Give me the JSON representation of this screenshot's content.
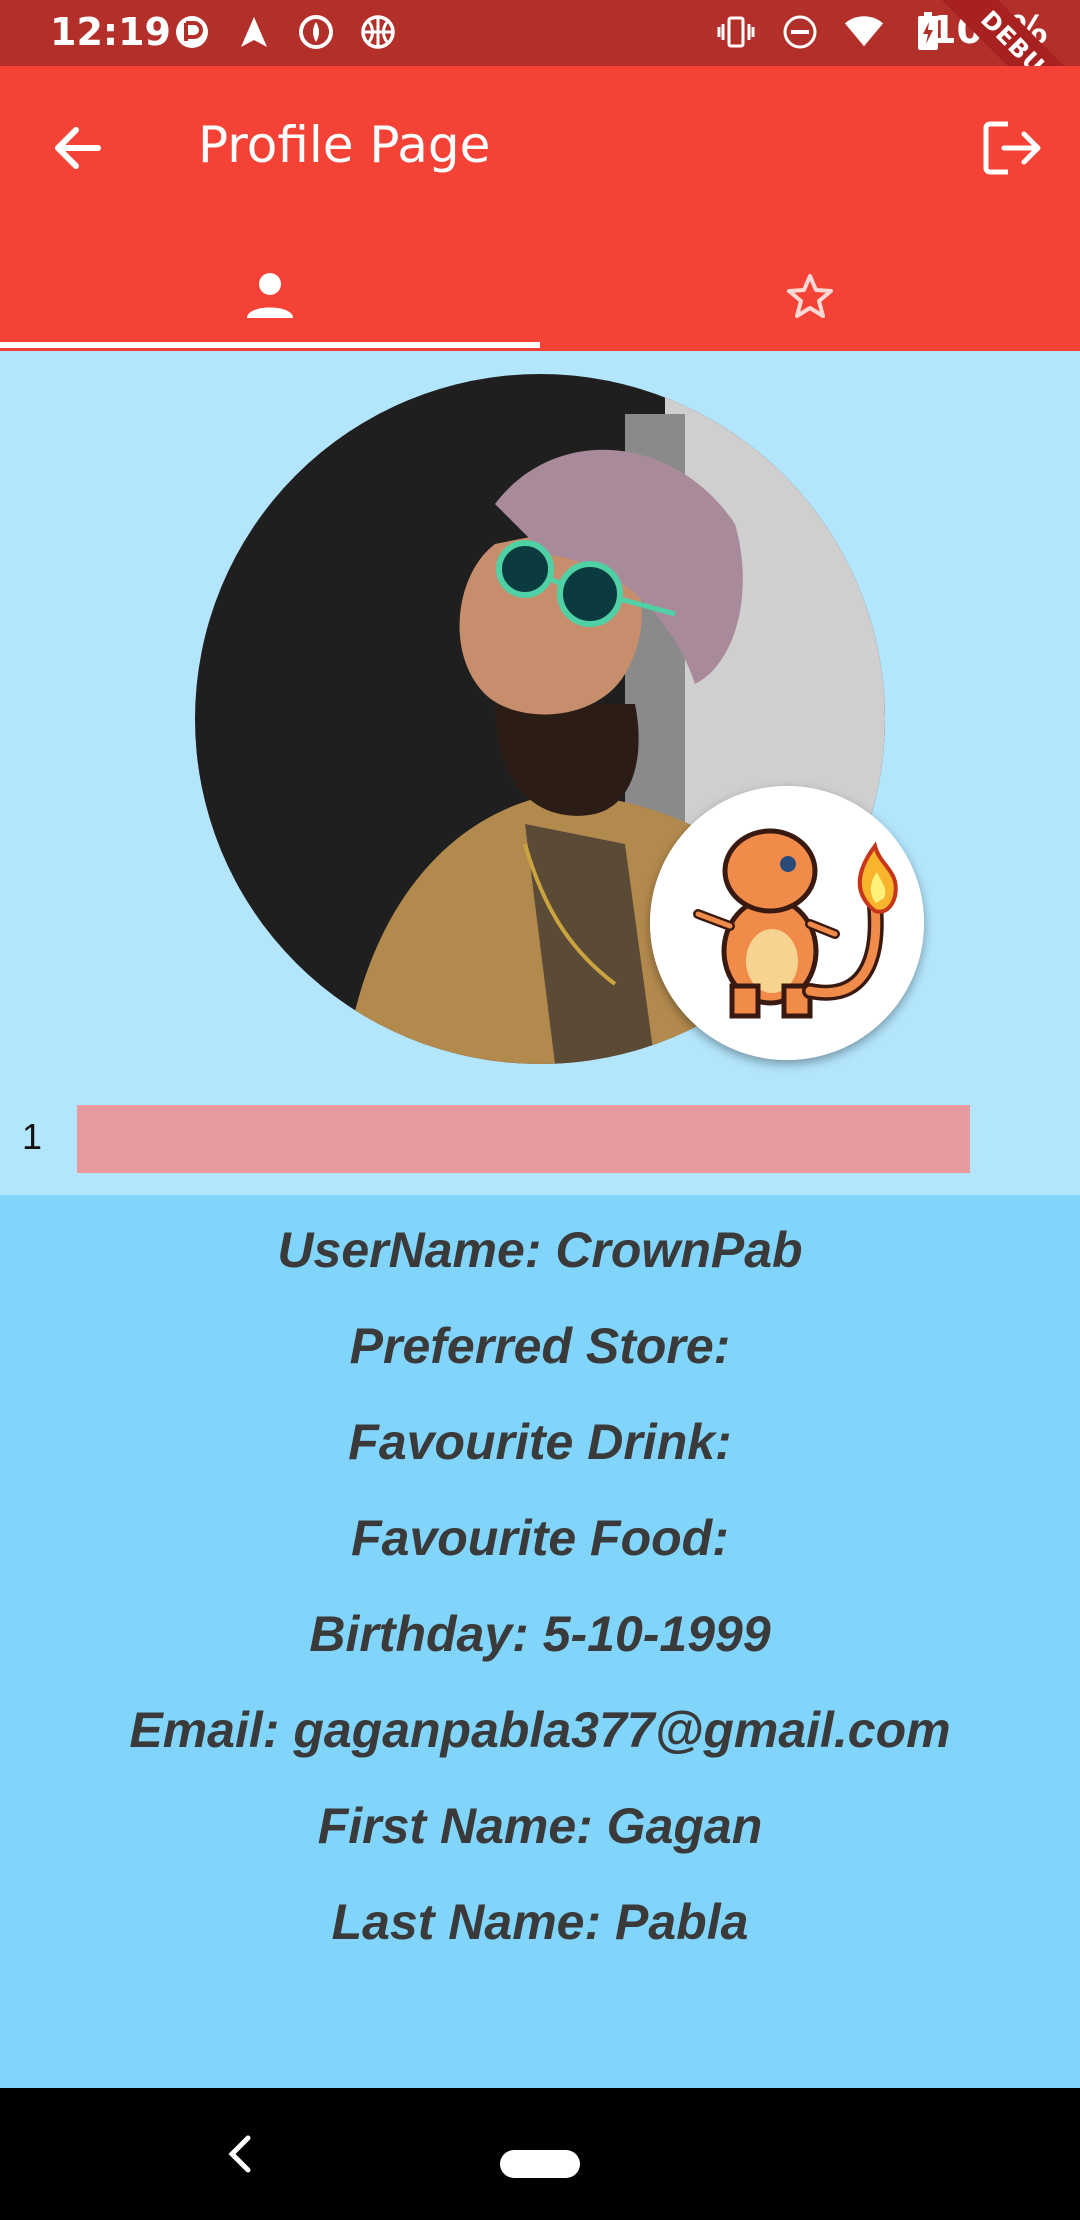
{
  "status_bar": {
    "time": "12:19",
    "left_icons": [
      "messenger-icon",
      "navigation-icon",
      "opera-icon",
      "basketball-icon"
    ],
    "right_icons": [
      "vibrate-icon",
      "do-not-disturb-icon",
      "wifi-icon",
      "battery-charging-icon"
    ],
    "battery": "100%",
    "debug_label": "DEBUG"
  },
  "app_bar": {
    "title": "Profile Page",
    "back_icon": "arrow-back-icon",
    "logout_icon": "logout-icon",
    "color": "#f44336"
  },
  "tabs": [
    {
      "icon": "person-icon",
      "selected": true
    },
    {
      "icon": "star-outline-icon",
      "selected": false
    }
  ],
  "profile": {
    "avatar": "profile-photo",
    "badge": "charmander-sprite",
    "level_label": "1",
    "level_progress": 0.0
  },
  "info": {
    "username": "UserName: CrownPab",
    "preferred_store": "Preferred Store:",
    "favourite_drink": "Favourite Drink:",
    "favourite_food": "Favourite Food:",
    "birthday": "Birthday: 5-10-1999",
    "email": "Email: gaganpabla377@gmail.com",
    "first_name": "First Name: Gagan",
    "last_name": "Last Name: Pabla"
  }
}
